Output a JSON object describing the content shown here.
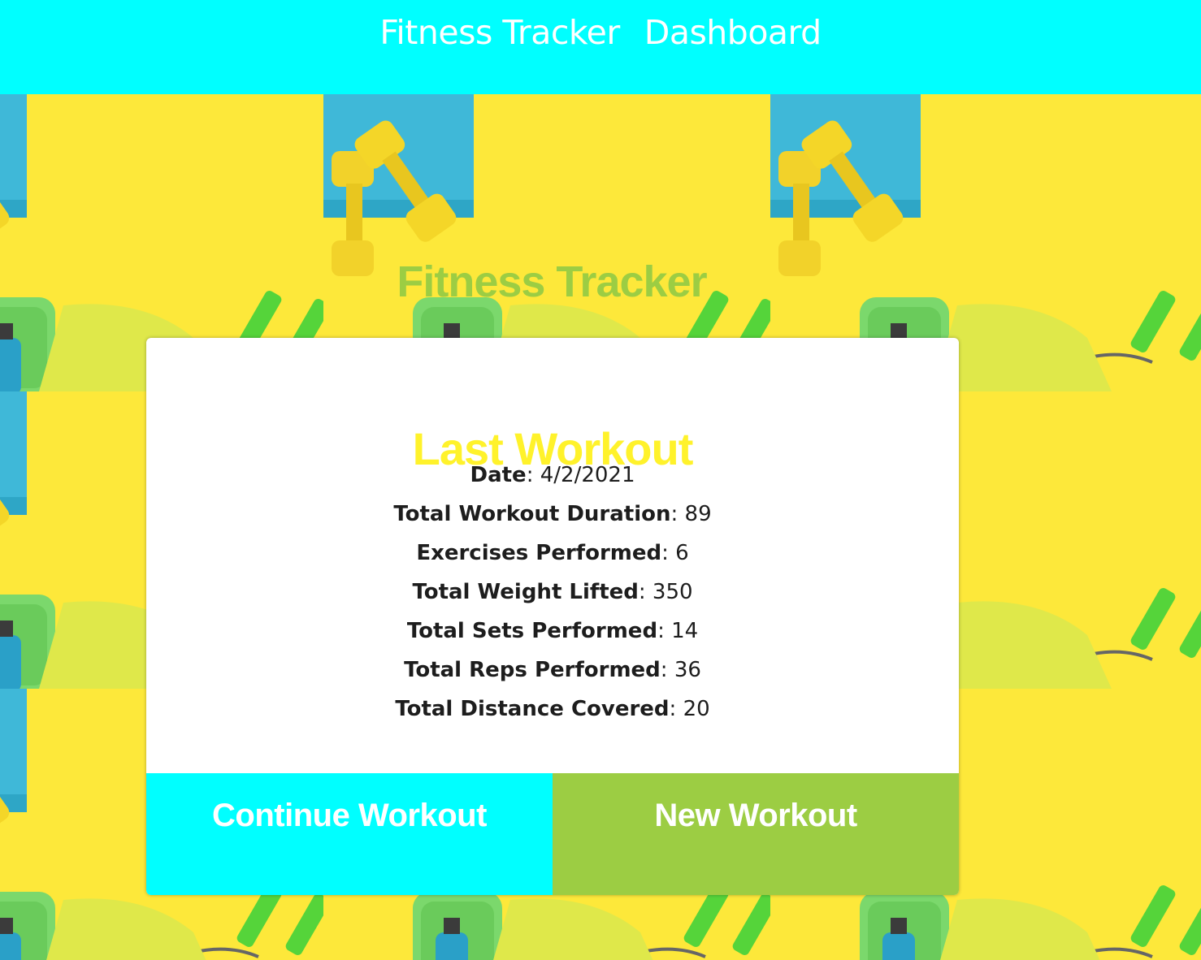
{
  "nav": {
    "title": "Fitness Tracker",
    "dashboard_link": "Dashboard"
  },
  "hero": {
    "title": "Fitness Tracker"
  },
  "card": {
    "title": "Last Workout",
    "stats": [
      {
        "label": "Date",
        "value": "4/2/2021"
      },
      {
        "label": "Total Workout Duration",
        "value": "89"
      },
      {
        "label": "Exercises Performed",
        "value": "6"
      },
      {
        "label": "Total Weight Lifted",
        "value": "350"
      },
      {
        "label": "Total Sets Performed",
        "value": "14"
      },
      {
        "label": "Total Reps Performed",
        "value": "36"
      },
      {
        "label": "Total Distance Covered",
        "value": "20"
      }
    ]
  },
  "buttons": {
    "continue_label": "Continue Workout",
    "new_label": "New Workout"
  },
  "colors": {
    "header": "#00ffff",
    "accent_green": "#9ccd43",
    "title_yellow": "#fff22b",
    "background_yellow": "#fde93b"
  },
  "background": {
    "icons": [
      "dumbbell-icon",
      "towel-icon",
      "jump-rope-icon",
      "water-bottle-icon",
      "hand-gripper-icon",
      "yoga-mat-icon"
    ]
  }
}
